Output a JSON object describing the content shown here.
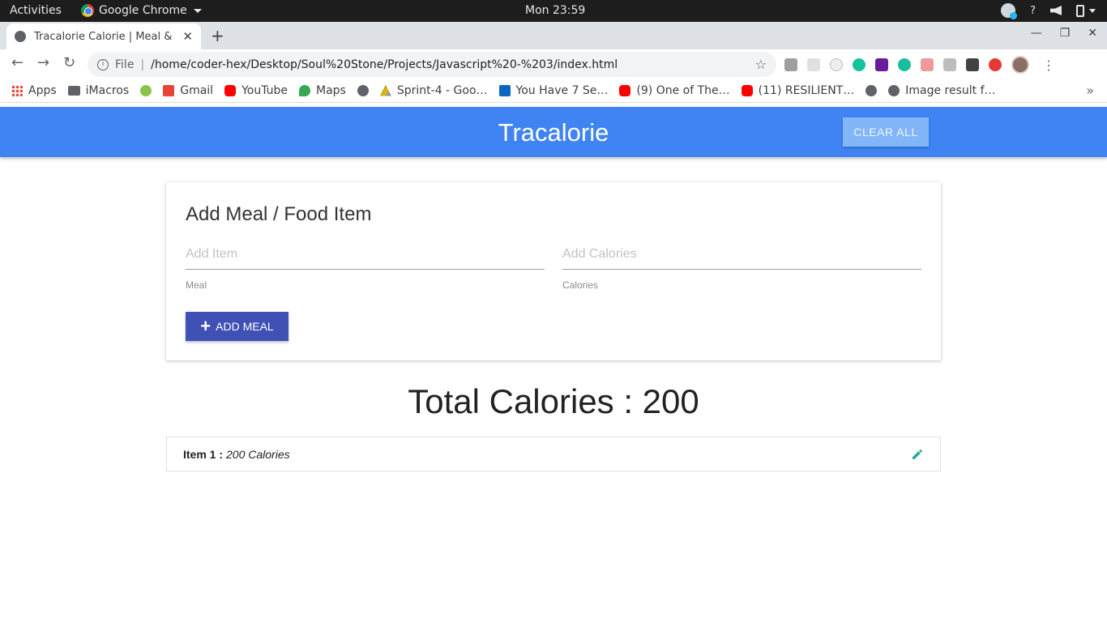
{
  "system_bar": {
    "activities": "Activities",
    "app_name": "Google Chrome",
    "clock": "Mon 23:59",
    "help": "?"
  },
  "browser": {
    "tab_title": "Tracalorie Calorie | Meal &",
    "new_tab": "+",
    "address_prefix": "File",
    "url": "/home/coder-hex/Desktop/Soul%20Stone/Projects/Javascript%20-%203/index.html",
    "bookmarks": [
      {
        "label": "Apps",
        "icon": "apps-icon"
      },
      {
        "label": "iMacros",
        "icon": "folder-icon"
      },
      {
        "label": "",
        "icon": "extension-icon"
      },
      {
        "label": "Gmail",
        "icon": "gmail-icon"
      },
      {
        "label": "YouTube",
        "icon": "youtube-icon"
      },
      {
        "label": "Maps",
        "icon": "maps-icon"
      },
      {
        "label": "",
        "icon": "globe-icon"
      },
      {
        "label": "Sprint-4 - Goo…",
        "icon": "drive-icon"
      },
      {
        "label": "You Have 7 Se…",
        "icon": "linkedin-icon"
      },
      {
        "label": "(9) One of The…",
        "icon": "youtube-icon"
      },
      {
        "label": "(11) RESILIENT…",
        "icon": "youtube-icon"
      },
      {
        "label": "",
        "icon": "globe-icon"
      },
      {
        "label": "Image result f…",
        "icon": "globe-icon"
      }
    ]
  },
  "app": {
    "brand": "Tracalorie",
    "clear_all": "CLEAR ALL",
    "form": {
      "title": "Add Meal / Food Item",
      "item_placeholder": "Add Item",
      "item_helper": "Meal",
      "calories_placeholder": "Add Calories",
      "calories_helper": "Calories",
      "add_button": "ADD MEAL"
    },
    "total": "Total Calories : 200",
    "items": [
      {
        "name": "Item 1 :",
        "calories": "200 Calories"
      }
    ]
  },
  "colors": {
    "navbar": "#3f84f2",
    "add_button": "#3f51b5",
    "edit_icon": "#26a69a"
  }
}
